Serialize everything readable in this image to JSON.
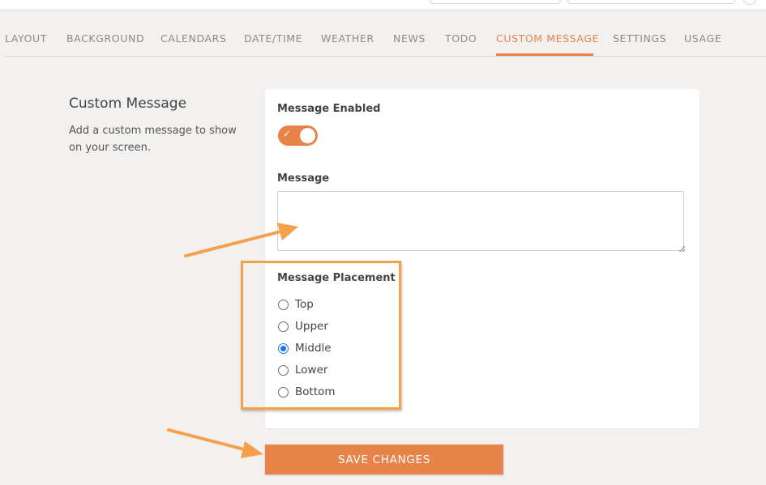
{
  "tabs": [
    {
      "label": "LAYOUT"
    },
    {
      "label": "BACKGROUND"
    },
    {
      "label": "CALENDARS"
    },
    {
      "label": "DATE/TIME"
    },
    {
      "label": "WEATHER"
    },
    {
      "label": "NEWS"
    },
    {
      "label": "TODO"
    },
    {
      "label": "CUSTOM MESSAGE",
      "active": true
    },
    {
      "label": "SETTINGS"
    },
    {
      "label": "USAGE"
    }
  ],
  "section": {
    "title": "Custom Message",
    "description": "Add a custom message to show on your screen."
  },
  "form": {
    "enabled_label": "Message Enabled",
    "enabled": true,
    "message_label": "Message",
    "message_value": "",
    "placement_label": "Message Placement",
    "placement_options": [
      "Top",
      "Upper",
      "Middle",
      "Lower",
      "Bottom"
    ],
    "placement_selected": "Middle"
  },
  "save_label": "SAVE CHANGES",
  "colors": {
    "accent": "#e8834a",
    "annotation": "#f5a04b",
    "radio_selected": "#1a73e8"
  }
}
